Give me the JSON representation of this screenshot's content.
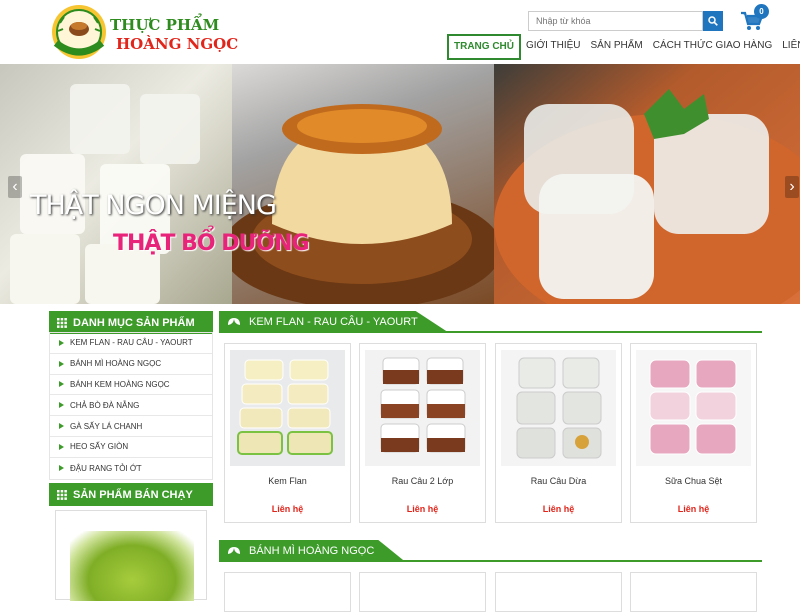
{
  "brand": {
    "line1": "THỰC PHẨM",
    "line2": "HOÀNG NGỌC",
    "logo_text": "HOÀNG NGỌC"
  },
  "search": {
    "placeholder": "Nhập từ khóa"
  },
  "cart": {
    "count": "0"
  },
  "nav": {
    "items": [
      {
        "label": "TRANG CHỦ",
        "active": true
      },
      {
        "label": "GIỚI THIỆU"
      },
      {
        "label": "SẢN PHẨM"
      },
      {
        "label": "CÁCH THỨC GIAO HÀNG"
      },
      {
        "label": "LIÊN HỆ"
      }
    ]
  },
  "slider": {
    "tagline1": "THẬT NGON MIỆNG",
    "tagline2": "THẬT BỔ DƯỠNG"
  },
  "sidebar": {
    "categories_title": "DANH MỤC SẢN PHẨM",
    "categories": [
      "KEM FLAN - RAU CÂU - YAOURT",
      "BÁNH MÌ HOÀNG NGỌC",
      "BÁNH KEM HOÀNG NGỌC",
      "CHẢ BÒ ĐÀ NẴNG",
      "GÀ SẤY LÁ CHANH",
      "HEO SẤY GIÒN",
      "ĐẬU RANG TỎI ỚT"
    ],
    "bestseller_title": "SẢN PHẨM BÁN CHẠY"
  },
  "sections": [
    {
      "title": "KEM FLAN - RAU CÂU - YAOURT",
      "products": [
        {
          "name": "Kem Flan",
          "price": "Liên hệ"
        },
        {
          "name": "Rau Câu 2 Lớp",
          "price": "Liên hệ"
        },
        {
          "name": "Rau Câu Dừa",
          "price": "Liên hệ"
        },
        {
          "name": "Sữa Chua Sệt",
          "price": "Liên hệ"
        }
      ]
    },
    {
      "title": "BÁNH MÌ HOÀNG NGỌC"
    }
  ],
  "colors": {
    "green": "#3d9b2a",
    "red": "#e1251b",
    "blue": "#1f76bf"
  }
}
